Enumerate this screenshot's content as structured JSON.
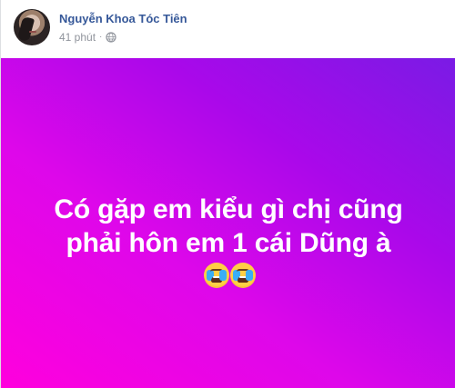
{
  "post": {
    "author_name": "Nguyễn Khoa Tóc Tiên",
    "time_ago": "41 phút",
    "separator": "·",
    "privacy_icon": "globe-icon",
    "message_line_1": "Có gặp em kiểu gì chị cũng",
    "message_line_2": "phải hôn em 1 cái Dũng à",
    "emoji_icons": [
      "crying-face-icon",
      "crying-face-icon"
    ]
  },
  "colors": {
    "author_link": "#365899",
    "meta_text": "#90949c",
    "gradient_start": "#ff00dd",
    "gradient_mid": "#aa08ea",
    "gradient_end": "#7a1be5",
    "message_text": "#ffffff"
  }
}
